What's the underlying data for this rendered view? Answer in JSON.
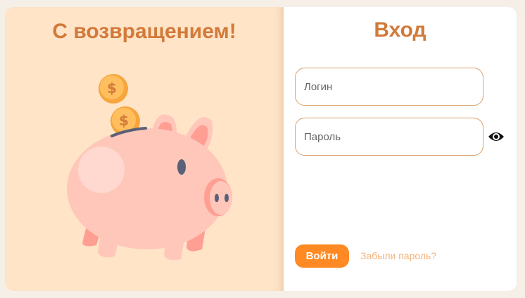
{
  "welcome": {
    "title": "С возвращением!",
    "illustration": "piggy-bank-with-coins"
  },
  "login_form": {
    "title": "Вход",
    "login_placeholder": "Логин",
    "password_placeholder": "Пароль",
    "show_password_icon": "eye-icon",
    "submit_label": "Войти",
    "forgot_label": "Забыли пароль?"
  },
  "colors": {
    "page_bg": "#f5efe8",
    "left_panel_bg": "#ffe4c8",
    "accent_title": "#d27a3a",
    "button_bg": "#ff8a24",
    "link": "#f4b27a",
    "field_border": "#d9a06a",
    "pig": "#ffc7ba",
    "coin": "#f7a53c"
  }
}
